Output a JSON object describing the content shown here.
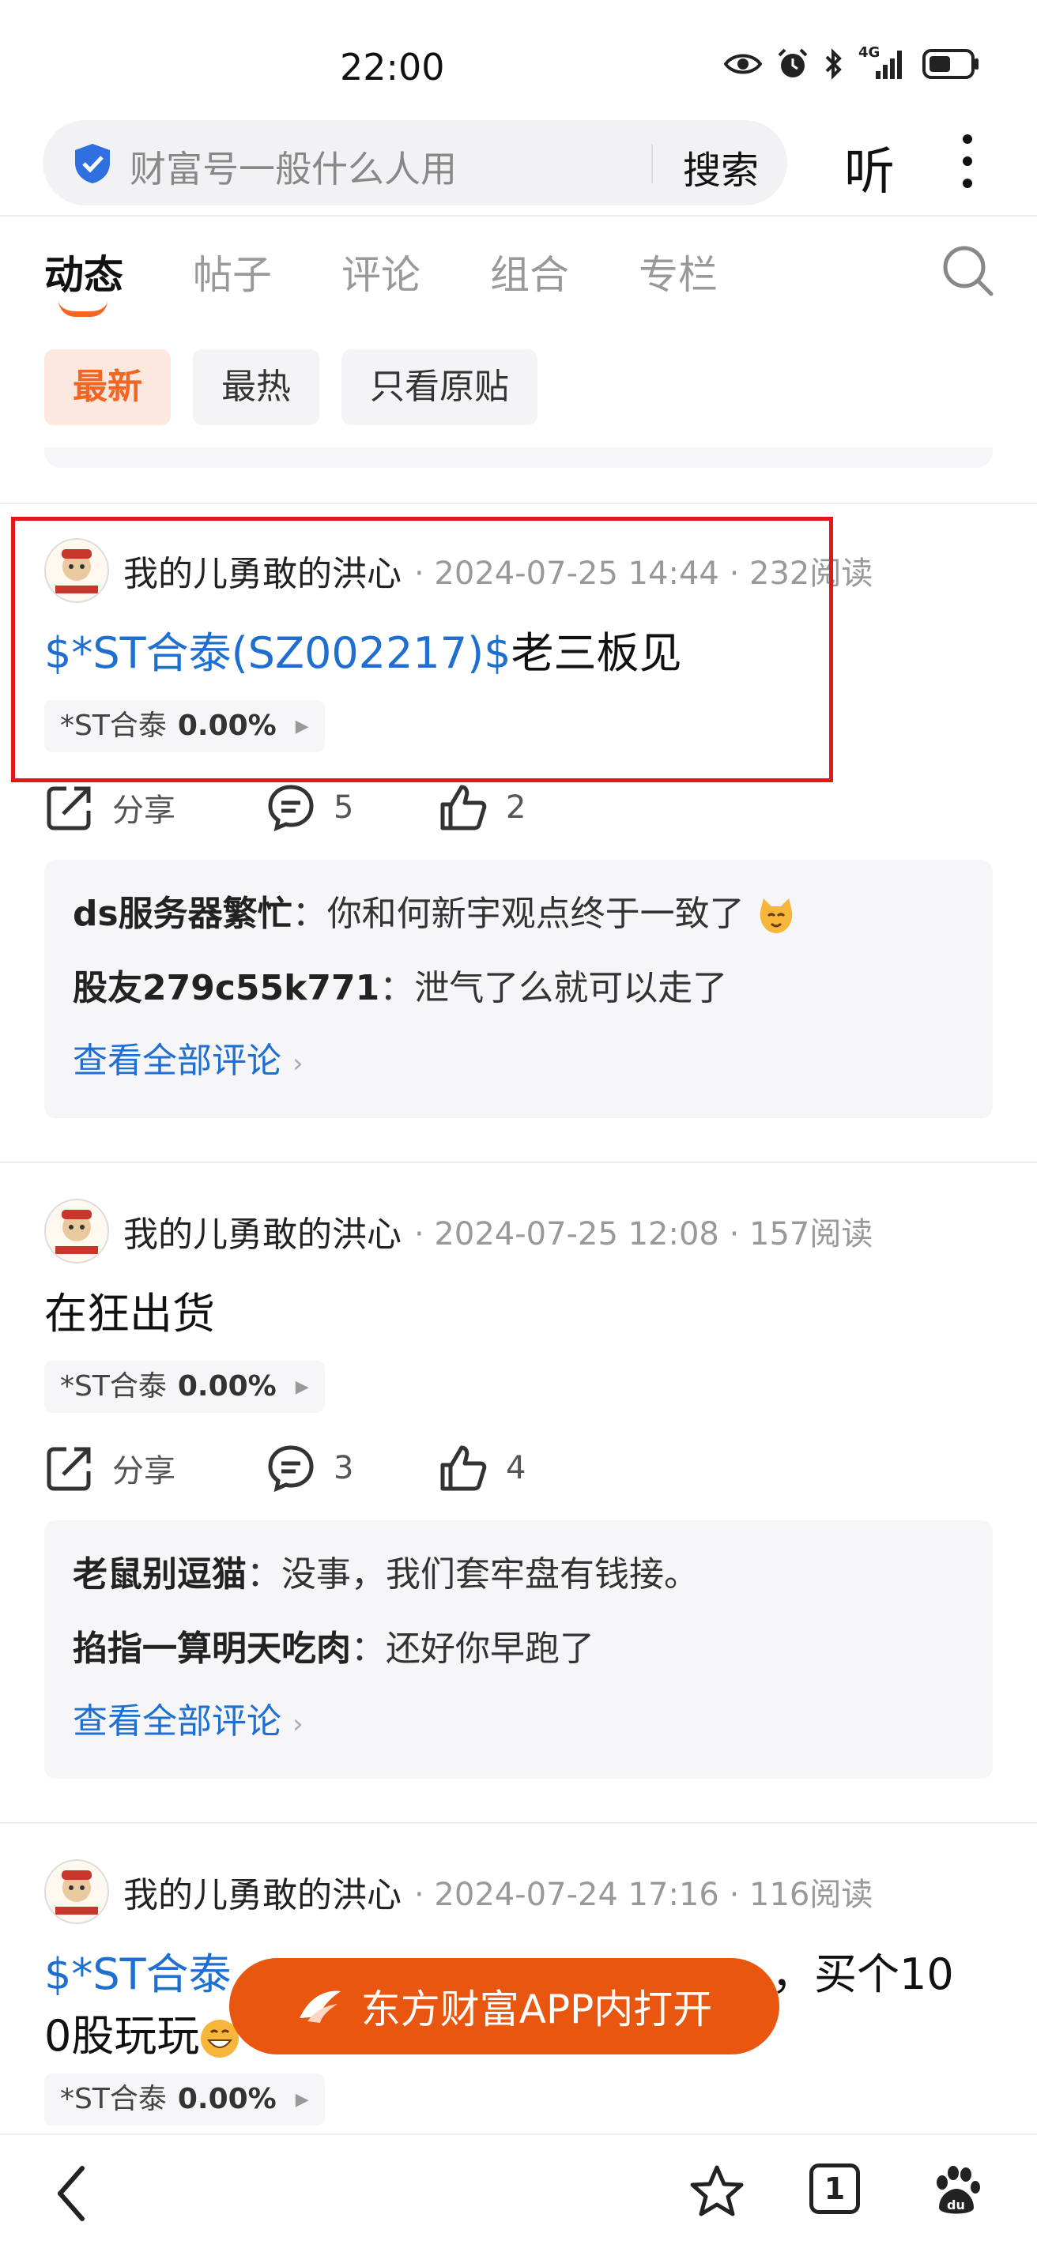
{
  "status_bar": {
    "time": "22:00",
    "network": "4G"
  },
  "search_bar": {
    "query": "财富号一般什么人用",
    "search_label": "搜索"
  },
  "listen_label": "听",
  "tabs": [
    "动态",
    "帖子",
    "评论",
    "组合",
    "专栏"
  ],
  "filters": [
    "最新",
    "最热",
    "只看原贴"
  ],
  "posts": [
    {
      "author": "我的儿勇敢的洪心",
      "meta": "· 2024-07-25 14:44 · 232阅读",
      "content_link": "$*ST合泰(SZ002217)$",
      "content_text": "老三板见",
      "stock_name": "*ST合泰",
      "stock_change": "0.00%",
      "share_label": "分享",
      "comment_count": "5",
      "like_count": "2",
      "comments": [
        {
          "user": "ds服务器繁忙",
          "text": "你和何新宇观点终于一致了"
        },
        {
          "user": "股友279c55k771",
          "text": "泄气了么就可以走了"
        }
      ],
      "view_all": "查看全部评论"
    },
    {
      "author": "我的儿勇敢的洪心",
      "meta": "· 2024-07-25 12:08 · 157阅读",
      "content_text": "在狂出货",
      "stock_name": "*ST合泰",
      "stock_change": "0.00%",
      "share_label": "分享",
      "comment_count": "3",
      "like_count": "4",
      "comments": [
        {
          "user": "老鼠别逗猫",
          "text": "没事，我们套牢盘有钱接。"
        },
        {
          "user": "掐指一算明天吃肉",
          "text": "还好你早跑了"
        }
      ],
      "view_all": "查看全部评论"
    },
    {
      "author": "我的儿勇敢的洪心",
      "meta": "· 2024-07-24 17:16 · 116阅读",
      "content_link": "$*ST合泰",
      "content_text": "，买个10",
      "content_line2": "0股玩玩",
      "stock_name": "*ST合泰",
      "stock_change": "0.00%"
    }
  ],
  "open_app": "东方财富APP内打开",
  "bottom_nav": {
    "tab_count": "1"
  },
  "colors": {
    "accent": "#f26522",
    "link": "#1f6fd1",
    "highlight_box": "#e01818",
    "open_app": "#e9560f"
  }
}
